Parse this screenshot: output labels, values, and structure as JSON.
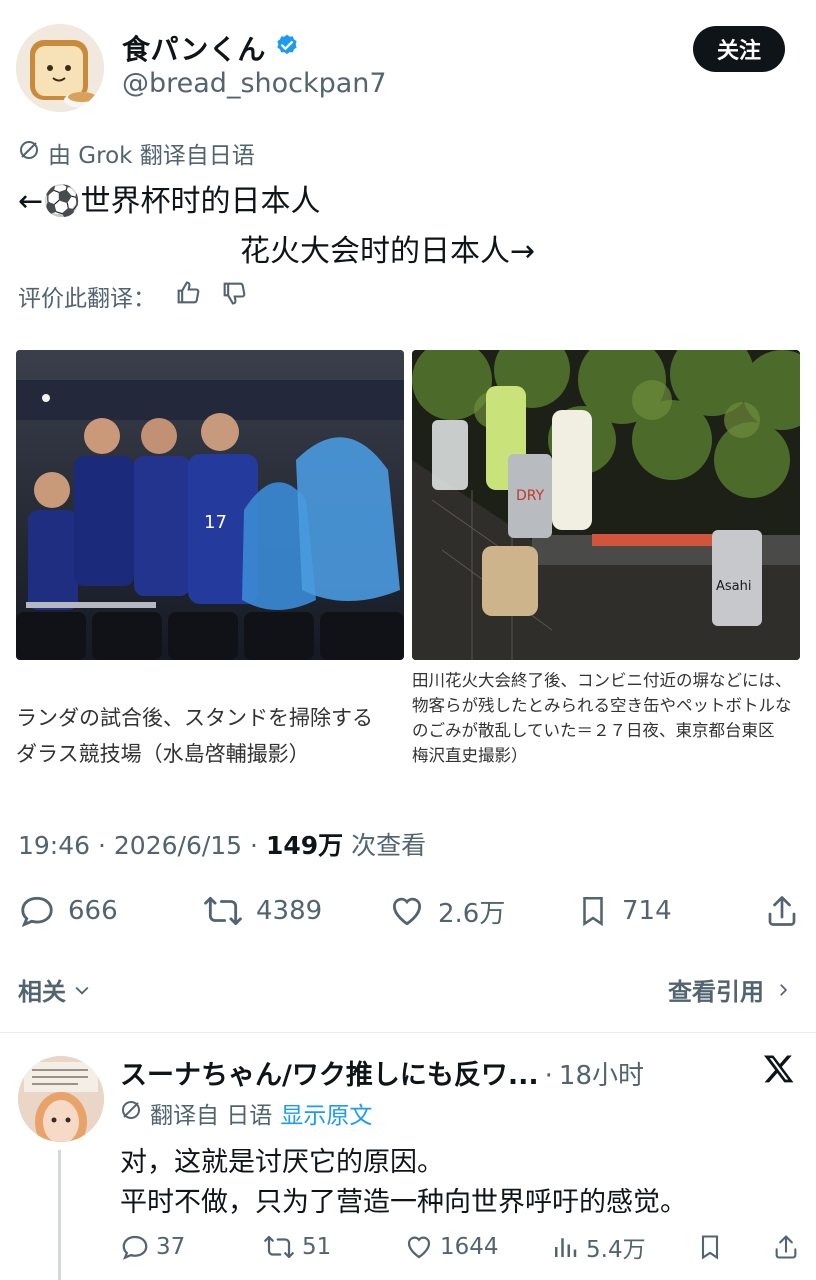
{
  "author": {
    "display_name": "食パンくん",
    "handle": "@bread_shockpan7",
    "follow_label": "关注"
  },
  "translation": {
    "note": "由 Grok 翻译自日语",
    "rate_label": "评价此翻译："
  },
  "tweet": {
    "line1": "←⚽世界杯时的日本人",
    "line2": "花火大会时的日本人→"
  },
  "photos": {
    "left_caption": [
      "ランダの試合後、スタンドを掃除する",
      "ダラス競技場（水島啓輔撮影）"
    ],
    "right_caption": [
      "田川花火大会終了後、コンビニ付近の塀などには、",
      "物客らが残したとみられる空き缶やペットボトルな",
      "のごみが散乱していた＝２７日夜、東京都台東区",
      "梅沢直史撮影）"
    ],
    "left_jersey_number": "17",
    "right_can_label": "Asahi",
    "right_can_top": "DRY"
  },
  "meta": {
    "time": "19:46",
    "date": "2026/6/15",
    "views": "149万",
    "views_suffix": "次查看"
  },
  "stats": {
    "replies": "666",
    "retweets": "4389",
    "likes": "2.6万",
    "bookmarks": "714"
  },
  "related": {
    "label": "相关",
    "quotes_label": "查看引用"
  },
  "reply": {
    "name": "スーナちゃん/ワク推しにも反ワ...",
    "time": "18小时",
    "translated_from": "翻译自 日语",
    "show_original": "显示原文",
    "text_line1": "对，这就是讨厌它的原因。",
    "text_line2": "平时不做，只为了营造一种向世界呼吁的感觉。",
    "replies": "37",
    "retweets": "51",
    "likes": "1644",
    "views": "5.4万"
  },
  "colors": {
    "text": "#0f1419",
    "muted": "#536471",
    "verified": "#1d9bf0",
    "link": "#1d9bf0"
  }
}
